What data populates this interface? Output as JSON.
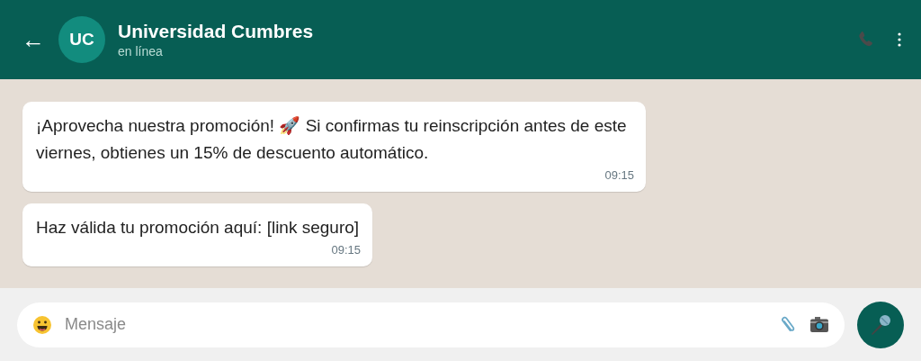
{
  "header": {
    "back": "←",
    "avatar": "UC",
    "title": "Universidad Cumbres",
    "status": "en línea"
  },
  "messages": [
    {
      "text": "¡Aprovecha nuestra promoción! 🚀 Si confirmas tu reinscripción antes de este viernes, obtienes un 15% de descuento automático.",
      "time": "09:15"
    },
    {
      "text": "Haz válida tu promoción aquí: [link seguro]",
      "time": "09:15"
    }
  ],
  "composer": {
    "placeholder": "Mensaje"
  }
}
